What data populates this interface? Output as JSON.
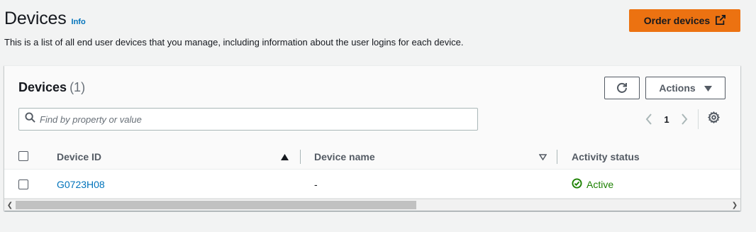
{
  "page": {
    "title": "Devices",
    "info_link": "Info",
    "description": "This is a list of all end user devices that you manage, including information about the user logins for each device.",
    "order_button": "Order devices"
  },
  "table": {
    "title": "Devices",
    "count": "(1)",
    "actions_label": "Actions",
    "search_placeholder": "Find by property or value",
    "current_page": "1",
    "columns": {
      "device_id": "Device ID",
      "device_name": "Device name",
      "activity_status": "Activity status"
    },
    "rows": [
      {
        "device_id": "G0723H08",
        "device_name": "-",
        "activity_status": "Active"
      }
    ]
  },
  "icons": {
    "external": "external-link-icon",
    "refresh": "refresh-icon",
    "caret": "caret-down-icon",
    "search": "search-icon",
    "settings": "gear-icon",
    "sort_asc": "sort-ascending-icon",
    "sort_none": "sort-unsorted-icon",
    "status_ok": "status-success-icon"
  },
  "colors": {
    "accent": "#ec7211",
    "link": "#0073bb",
    "success": "#1d8102"
  }
}
